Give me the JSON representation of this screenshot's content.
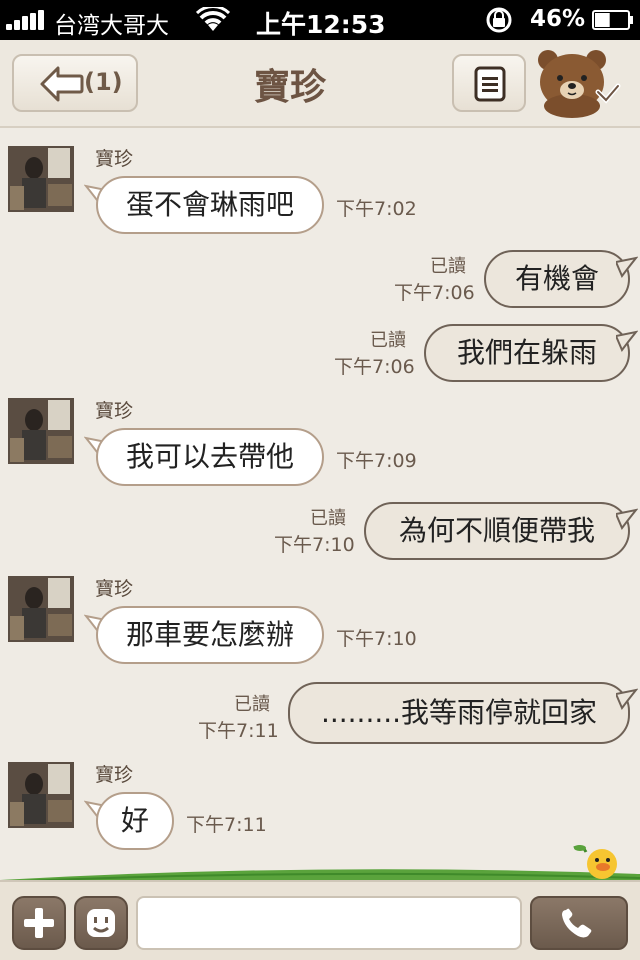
{
  "status_bar": {
    "carrier": "台湾大哥大",
    "time": "上午12:53",
    "battery": "46%",
    "battery_level": 0.46
  },
  "header": {
    "back_count": "(1)",
    "title": "寶珍"
  },
  "messages": [
    {
      "sender": "寶珍",
      "text": "蛋不會琳雨吧",
      "time": "下午7:02"
    },
    {
      "text": "有機會",
      "time": "下午7:06",
      "read": "已讀"
    },
    {
      "text": "我們在躲雨",
      "time": "下午7:06",
      "read": "已讀"
    },
    {
      "sender": "寶珍",
      "text": "我可以去帶他",
      "time": "下午7:09"
    },
    {
      "text": "為何不順便帶我",
      "time": "下午7:10",
      "read": "已讀"
    },
    {
      "sender": "寶珍",
      "text": "那車要怎麼辦",
      "time": "下午7:10"
    },
    {
      "text": ".........我等雨停就回家",
      "time": "下午7:11",
      "read": "已讀"
    },
    {
      "sender": "寶珍",
      "text": "好",
      "time": "下午7:11"
    }
  ],
  "input": {
    "value": "",
    "placeholder": ""
  },
  "icons": {
    "back": "back-arrow-icon",
    "menu": "menu-list-icon",
    "bear": "brown-bear-icon",
    "plus": "plus-icon",
    "sticker": "sticker-face-icon",
    "call": "phone-icon"
  },
  "colors": {
    "background": "#efebe4",
    "accent": "#6d5443",
    "incoming_bubble": "#ffffff",
    "outgoing_bubble": "#ece6dc"
  }
}
